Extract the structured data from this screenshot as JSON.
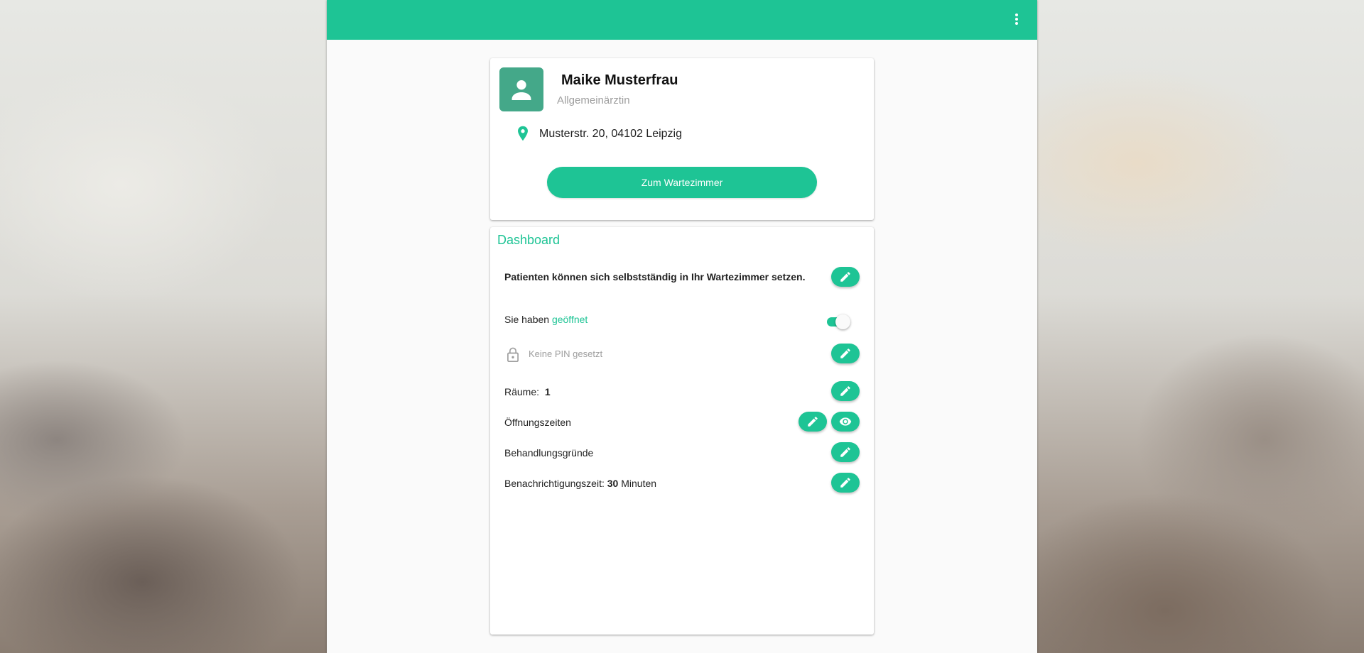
{
  "app": {
    "menu_icon": "more-vert-icon",
    "accent_color": "#1ec495"
  },
  "profile": {
    "avatar_icon": "person-icon",
    "name": "Maike Musterfrau",
    "title": "Allgemeinärztin",
    "location_icon": "map-pin-icon",
    "address": "Musterstr. 20, 04102 Leipzig",
    "waiting_room_button": "Zum Wartezimmer"
  },
  "dashboard": {
    "title": "Dashboard",
    "self_checkin_text": "Patienten können sich selbstständig in Ihr Wartezimmer setzen.",
    "status": {
      "prefix": "Sie haben ",
      "value": "geöffnet",
      "toggle_on": true
    },
    "pin": {
      "icon": "lock-icon",
      "text": "Keine PIN gesetzt"
    },
    "rooms": {
      "label": "Räume:",
      "value": "1"
    },
    "opening_hours": {
      "label": "Öffnungszeiten"
    },
    "treatment_reasons": {
      "label": "Behandlungsgründe"
    },
    "notification_time": {
      "label": "Benachrichtigungszeit:",
      "value": "30",
      "unit": "Minuten"
    },
    "edit_icon": "pencil-icon",
    "view_icon": "eye-icon"
  }
}
